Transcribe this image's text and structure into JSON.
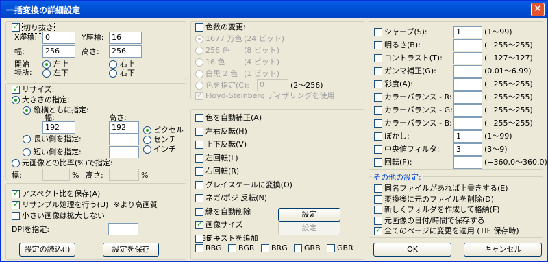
{
  "title": "一括変換の詳細設定",
  "crop": {
    "label": "切り抜き",
    "x_label": "X座標:",
    "x": "0",
    "y_label": "Y座標:",
    "y": "16",
    "w_label": "幅:",
    "w": "256",
    "h_label": "高さ:",
    "h": "256",
    "start_label": "開始場所:",
    "start_l1": "開始",
    "start_l2": "場所:",
    "tl": "左上",
    "tr": "右上",
    "bl": "左下",
    "br": "右下"
  },
  "resize": {
    "label": "リサイズ:",
    "size_label": "大きさの指定:",
    "both_label": "縦横ともに指定:",
    "width_label": "幅:",
    "height_label": "高さ:",
    "width": "192",
    "height": "192",
    "pixel": "ピクセル",
    "cm": "センチ",
    "inch": "インチ",
    "long_label": "長い側を指定:",
    "short_label": "短い側を指定:",
    "ratio_label": "元画像との比率(%)で指定:",
    "ratio_w_label": "幅:",
    "ratio_h_label": "高さ:",
    "pct": "%"
  },
  "options": {
    "aspect": "アスペクト比を保存(A)",
    "resample": "リサンプル処理を行う(U)",
    "resample_note": "※より高画質",
    "no_enlarge": "小さい画像は拡大しない",
    "dpi_label": "DPIを指定:"
  },
  "buttons": {
    "load": "設定の読込(I)",
    "save": "設定を保存",
    "ok": "OK",
    "cancel": "キャンセル",
    "set1": "設定",
    "set2": "設定"
  },
  "colors": {
    "label": "色数の変更:",
    "c1": "1677 万色",
    "c1b": "(24 ビット)",
    "c2": "256 色",
    "c2b": "(8 ビット)",
    "c3": "16 色",
    "c3b": "(4 ビット)",
    "c4": "白黒 2 色",
    "c4b": "(1 ビット)",
    "c5": "色を指定(C):",
    "c5v": "0",
    "c5r": "(2〜256)",
    "dither": "Floyd-Steinberg ディザリングを使用"
  },
  "transforms": [
    "色を自動補正(A)",
    "左右反転(H)",
    "上下反転(V)",
    "左回転(L)",
    "右回転(R)",
    "グレイスケールに変換(O)",
    "ネガ/ポジ 反転(N)",
    "縁を自動削除",
    "画像サイズ",
    "テキストを追加"
  ],
  "rgb": {
    "label": "RGB →",
    "opts": [
      "RBG",
      "BGR",
      "BRG",
      "GRB",
      "GBR"
    ]
  },
  "filters": [
    {
      "label": "シャープ(S):",
      "value": "1",
      "range": "(1〜99)"
    },
    {
      "label": "明るさ(B):",
      "value": "",
      "range": "(−255〜255)"
    },
    {
      "label": "コントラスト(T):",
      "value": "",
      "range": "(−127〜127)"
    },
    {
      "label": "ガンマ補正(G):",
      "value": "",
      "range": "(0.01〜6.99)"
    },
    {
      "label": "彩度(A):",
      "value": "",
      "range": "(−255〜255)"
    },
    {
      "label": "カラーバランス - R:",
      "value": "",
      "range": "(−255〜255)"
    },
    {
      "label": "カラーバランス - G:",
      "value": "",
      "range": "(−255〜255)"
    },
    {
      "label": "カラーバランス - B:",
      "value": "",
      "range": "(−255〜255)"
    },
    {
      "label": "ぼかし:",
      "value": "1",
      "range": "(1〜99)"
    },
    {
      "label": "中央値フィルタ:",
      "value": "3",
      "range": "(3〜9)"
    },
    {
      "label": "回転(F):",
      "value": "",
      "range": "(−360.0〜360.0)"
    }
  ],
  "other": {
    "label": "その他の設定:",
    "items": [
      "同名ファイルがあれば上書きする(E)",
      "変換後に元のファイルを削除(D)",
      "新しくフォルダを作成して格納(F)",
      "元画像の日付/時間で保存する",
      "全てのページに変更を適用 (TIF 保存時)"
    ]
  },
  "accent": "#0046d5"
}
